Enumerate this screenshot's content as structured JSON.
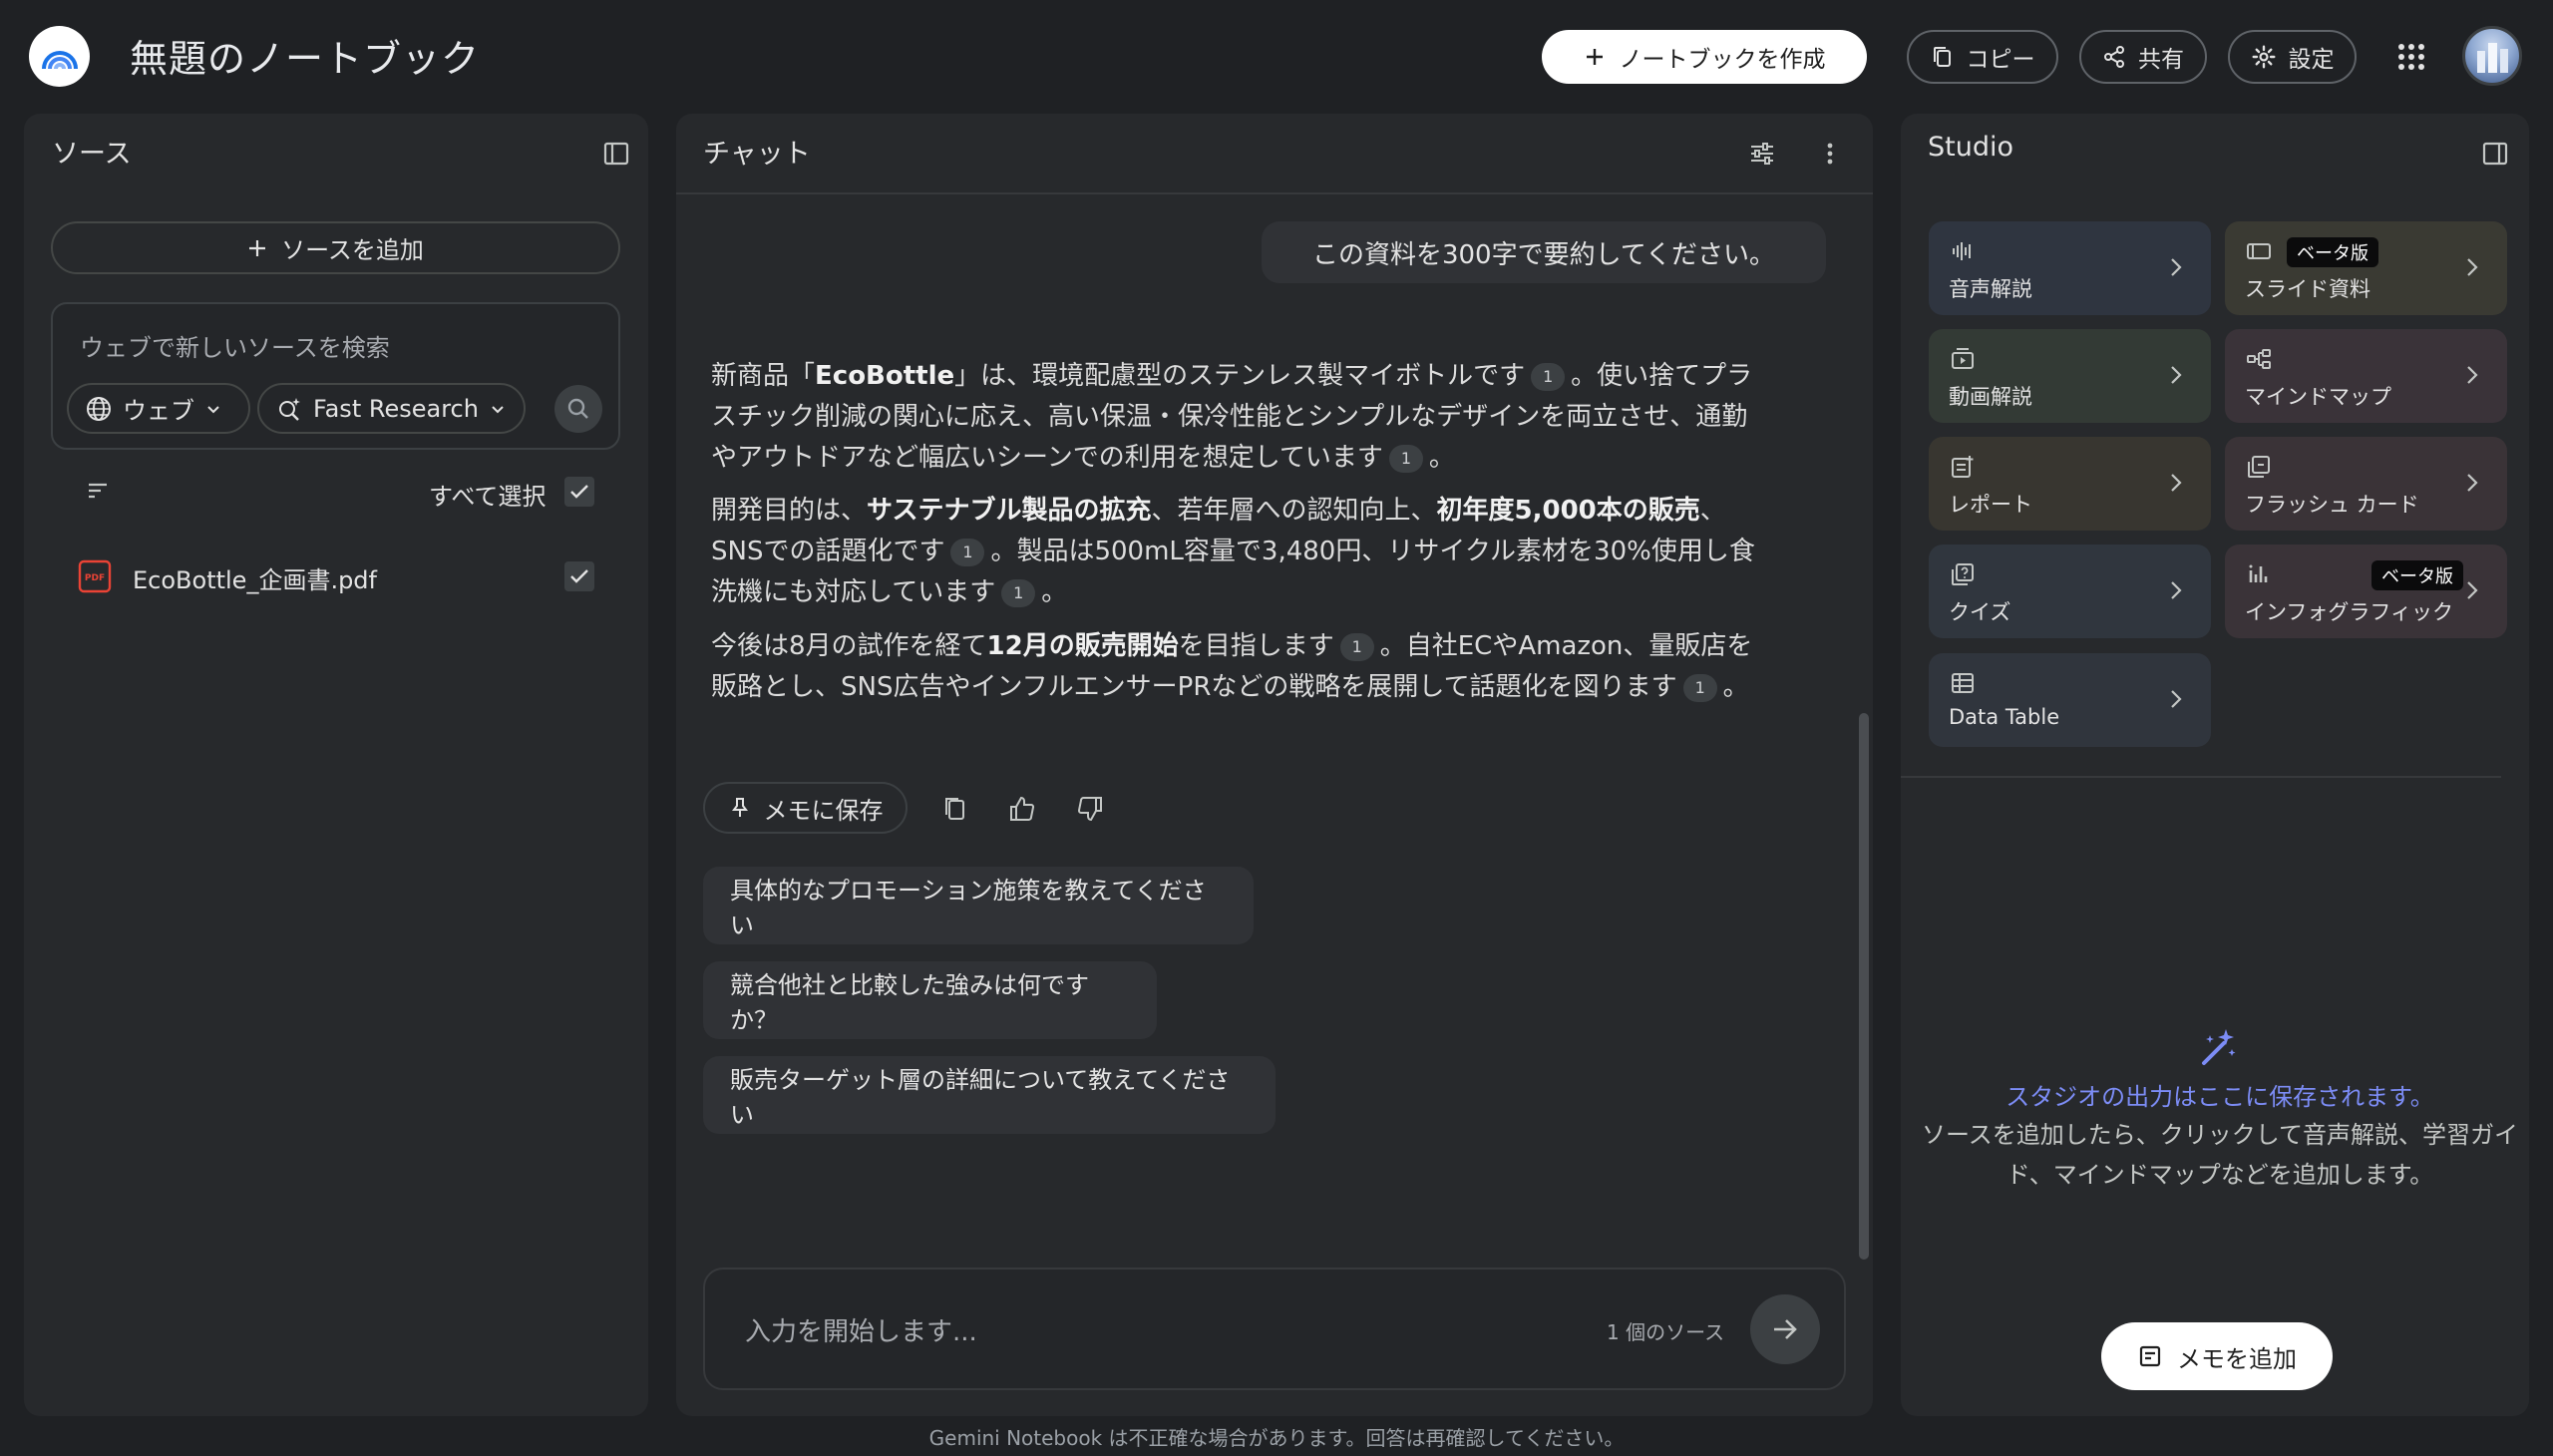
{
  "header": {
    "title": "無題のノートブック",
    "create_label": "ノートブックを作成",
    "copy_label": "コピー",
    "share_label": "共有",
    "settings_label": "設定"
  },
  "sources": {
    "title": "ソース",
    "add_label": "ソースを追加",
    "search_placeholder": "ウェブで新しいソースを検索",
    "web_chip": "ウェブ",
    "research_chip": "Fast Research",
    "select_all": "すべて選択",
    "files": [
      {
        "name": "EcoBottle_企画書.pdf",
        "badge": "PDF",
        "checked": true
      }
    ]
  },
  "chat": {
    "title": "チャット",
    "user_message": "この資料を300字で要約してください。",
    "paragraphs": [
      {
        "pre": "新商品「",
        "b1": "EcoBottle",
        "mid1": "」は、環境配慮型のステンレス製マイボトルです",
        "cite1": "1",
        "mid2": "。使い捨てプラスチック削減の関心に応え、高い保温・保冷性能とシンプルなデザインを両立させ、通勤やアウトドアなど幅広いシーンでの利用を想定しています",
        "cite2": "1",
        "end": "。"
      },
      {
        "pre": "開発目的は、",
        "b1": "サステナブル製品の拡充",
        "mid1": "、若年層への認知向上、",
        "b2": "初年度5,000本の販売",
        "mid2": "、SNSでの話題化です",
        "cite1": "1",
        "mid3": "。製品は500mL容量で3,480円、リサイクル素材を30%使用し食洗機にも対応しています",
        "cite2": "1",
        "end": "。"
      },
      {
        "pre": "今後は8月の試作を経て",
        "b1": "12月の販売開始",
        "mid1": "を目指します",
        "cite1": "1",
        "mid2": "。自社ECやAmazon、量販店を販路とし、SNS広告やインフルエンサーPRなどの戦略を展開して話題化を図ります",
        "cite2": "1",
        "end": "。"
      }
    ],
    "save_to_memo": "メモに保存",
    "suggestions": [
      "具体的なプロモーション施策を教えてください",
      "競合他社と比較した強みは何ですか？",
      "販売ターゲット層の詳細について教えてください"
    ],
    "input_placeholder": "入力を開始します...",
    "source_count": "1 個のソース"
  },
  "studio": {
    "title": "Studio",
    "tiles": [
      {
        "label": "音声解説",
        "icon": "audio-waveform-icon",
        "color": "#2f3540"
      },
      {
        "label": "スライド資料",
        "icon": "slides-icon",
        "color": "#3a3a33",
        "beta": "ベータ版"
      },
      {
        "label": "動画解説",
        "icon": "video-icon",
        "color": "#333a35"
      },
      {
        "label": "マインドマップ",
        "icon": "mindmap-icon",
        "color": "#3a3339"
      },
      {
        "label": "レポート",
        "icon": "report-icon",
        "color": "#383630"
      },
      {
        "label": "フラッシュ カード",
        "icon": "flashcard-icon",
        "color": "#3a3337"
      },
      {
        "label": "クイズ",
        "icon": "quiz-icon",
        "color": "#30363e"
      },
      {
        "label": "インフォグラフィック",
        "icon": "infographic-icon",
        "color": "#3a3338",
        "beta": "ベータ版"
      },
      {
        "label": "Data Table",
        "icon": "table-icon",
        "color": "#30353d"
      }
    ],
    "empty_title": "スタジオの出力はここに保存されます。",
    "empty_desc": "ソースを追加したら、クリックして音声解説、学習ガイド、マインドマップなどを追加します。",
    "add_memo": "メモを追加"
  },
  "footer": "Gemini Notebook は不正確な場合があります。回答は再確認してください。"
}
